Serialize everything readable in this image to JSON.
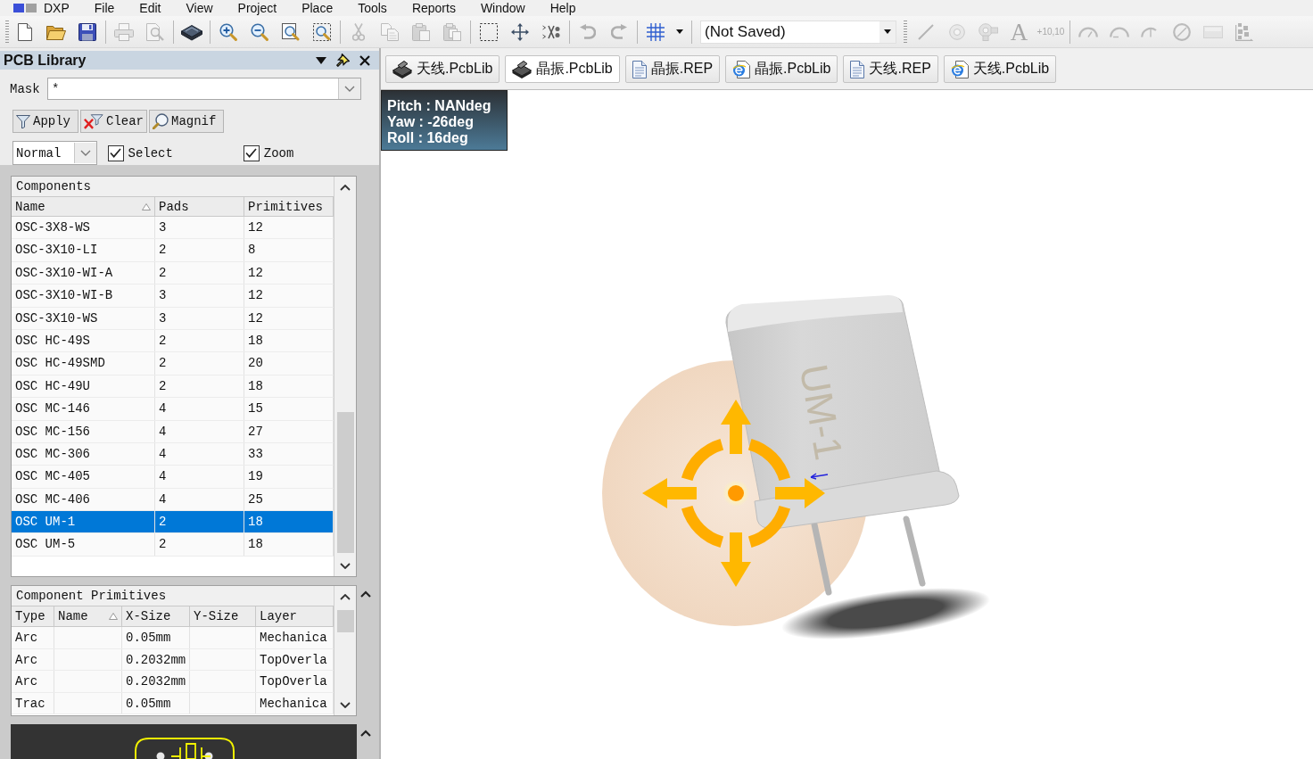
{
  "menu_bar": {
    "items": [
      "DXP",
      "File",
      "Edit",
      "View",
      "Project",
      "Place",
      "Tools",
      "Reports",
      "Window",
      "Help"
    ]
  },
  "toolbar": {
    "groups": [
      [
        {
          "kind": "icon",
          "disabled": false
        },
        {
          "kind": "icon",
          "disabled": false
        },
        {
          "kind": "icon",
          "disabled": false
        }
      ],
      [
        {
          "kind": "icon",
          "disabled": true
        },
        {
          "kind": "icon",
          "disabled": true
        }
      ],
      [
        {
          "kind": "icon",
          "disabled": false
        }
      ],
      [
        {
          "kind": "icon",
          "disabled": false
        },
        {
          "kind": "icon",
          "disabled": false
        },
        {
          "kind": "icon",
          "disabled": false
        },
        {
          "kind": "icon",
          "disabled": false
        }
      ],
      [
        {
          "kind": "icon",
          "disabled": true
        },
        {
          "kind": "icon",
          "disabled": true
        },
        {
          "kind": "icon",
          "disabled": true
        },
        {
          "kind": "icon",
          "disabled": true
        }
      ],
      [
        {
          "kind": "icon",
          "disabled": false
        },
        {
          "kind": "icon",
          "disabled": false
        },
        {
          "kind": "icon",
          "disabled": false
        }
      ],
      [
        {
          "kind": "icon",
          "disabled": true
        },
        {
          "kind": "icon",
          "disabled": true
        }
      ],
      [
        {
          "kind": "icon",
          "disabled": false
        },
        {
          "kind": "icon",
          "disabled": false
        }
      ],
      [
        {
          "kind": "combo",
          "value": "(Not Saved)"
        }
      ],
      [
        {
          "kind": "icon",
          "disabled": true
        },
        {
          "kind": "icon",
          "disabled": true
        },
        {
          "kind": "icon",
          "disabled": true
        },
        {
          "kind": "glyph",
          "label": "A",
          "disabled": true
        },
        {
          "kind": "text",
          "label": "+10,10",
          "disabled": true
        }
      ],
      [
        {
          "kind": "icon",
          "disabled": true
        },
        {
          "kind": "icon",
          "disabled": true
        },
        {
          "kind": "icon",
          "disabled": true
        },
        {
          "kind": "icon",
          "disabled": true
        },
        {
          "kind": "icon",
          "disabled": true
        },
        {
          "kind": "icon",
          "disabled": true
        }
      ]
    ]
  },
  "panel": {
    "title": "PCB Library",
    "mask": {
      "label": "Mask",
      "value": "*"
    },
    "buttons": [
      "Apply",
      "Clear",
      "Magnif"
    ],
    "view_mode": {
      "value": "Normal"
    },
    "checkboxes": [
      {
        "label": "Select",
        "checked": true
      },
      {
        "label": "Zoom",
        "checked": true
      }
    ],
    "components": {
      "title": "Components",
      "columns": [
        {
          "label": "Name",
          "sorted": true
        },
        {
          "label": "Pads",
          "sorted": false
        },
        {
          "label": "Primitives",
          "sorted": false
        }
      ],
      "rows": [
        {
          "name": "OSC-3X8-WS",
          "pads": "3",
          "primitives": "12",
          "selected": false
        },
        {
          "name": "OSC-3X10-LI",
          "pads": "2",
          "primitives": "8",
          "selected": false
        },
        {
          "name": "OSC-3X10-WI-A",
          "pads": "2",
          "primitives": "12",
          "selected": false
        },
        {
          "name": "OSC-3X10-WI-B",
          "pads": "3",
          "primitives": "12",
          "selected": false
        },
        {
          "name": "OSC-3X10-WS",
          "pads": "3",
          "primitives": "12",
          "selected": false
        },
        {
          "name": "OSC HC-49S",
          "pads": "2",
          "primitives": "18",
          "selected": false
        },
        {
          "name": "OSC HC-49SMD",
          "pads": "2",
          "primitives": "20",
          "selected": false
        },
        {
          "name": "OSC HC-49U",
          "pads": "2",
          "primitives": "18",
          "selected": false
        },
        {
          "name": "OSC MC-146",
          "pads": "4",
          "primitives": "15",
          "selected": false
        },
        {
          "name": "OSC MC-156",
          "pads": "4",
          "primitives": "27",
          "selected": false
        },
        {
          "name": "OSC MC-306",
          "pads": "4",
          "primitives": "33",
          "selected": false
        },
        {
          "name": "OSC MC-405",
          "pads": "4",
          "primitives": "19",
          "selected": false
        },
        {
          "name": "OSC MC-406",
          "pads": "4",
          "primitives": "25",
          "selected": false
        },
        {
          "name": "OSC UM-1",
          "pads": "2",
          "primitives": "18",
          "selected": true
        },
        {
          "name": "OSC UM-5",
          "pads": "2",
          "primitives": "18",
          "selected": false
        }
      ]
    },
    "primitives": {
      "title": "Component Primitives",
      "columns": [
        {
          "label": "Type",
          "sorted": false
        },
        {
          "label": "Name",
          "sorted": true
        },
        {
          "label": "X-Size",
          "sorted": false
        },
        {
          "label": "Y-Size",
          "sorted": false
        },
        {
          "label": "Layer",
          "sorted": false
        }
      ],
      "rows": [
        {
          "type": "Arc",
          "x_size": "0.05mm",
          "layer": "Mechanica"
        },
        {
          "type": "Arc",
          "x_size": "0.2032mm",
          "layer": "TopOverla"
        },
        {
          "type": "Arc",
          "x_size": "0.2032mm",
          "layer": "TopOverla"
        },
        {
          "type": "Trac",
          "x_size": "0.05mm",
          "layer": "Mechanica"
        }
      ]
    }
  },
  "document_tabs": [
    {
      "label": "天线.PcbLib",
      "kind": "library",
      "selected": false
    },
    {
      "label": "晶振.PcbLib",
      "kind": "library",
      "selected": true
    },
    {
      "label": "晶振.REP",
      "kind": "report",
      "selected": false
    },
    {
      "label": "晶振.PcbLib",
      "kind": "browser",
      "selected": false
    },
    {
      "label": "天线.REP",
      "kind": "report",
      "selected": false
    },
    {
      "label": "天线.PcbLib",
      "kind": "browser",
      "selected": false
    }
  ],
  "viewport": {
    "orientation_readout": [
      "Pitch : NANdeg",
      "Yaw : -26deg",
      "Roll : 16deg"
    ],
    "model_marking": "UM-1"
  }
}
